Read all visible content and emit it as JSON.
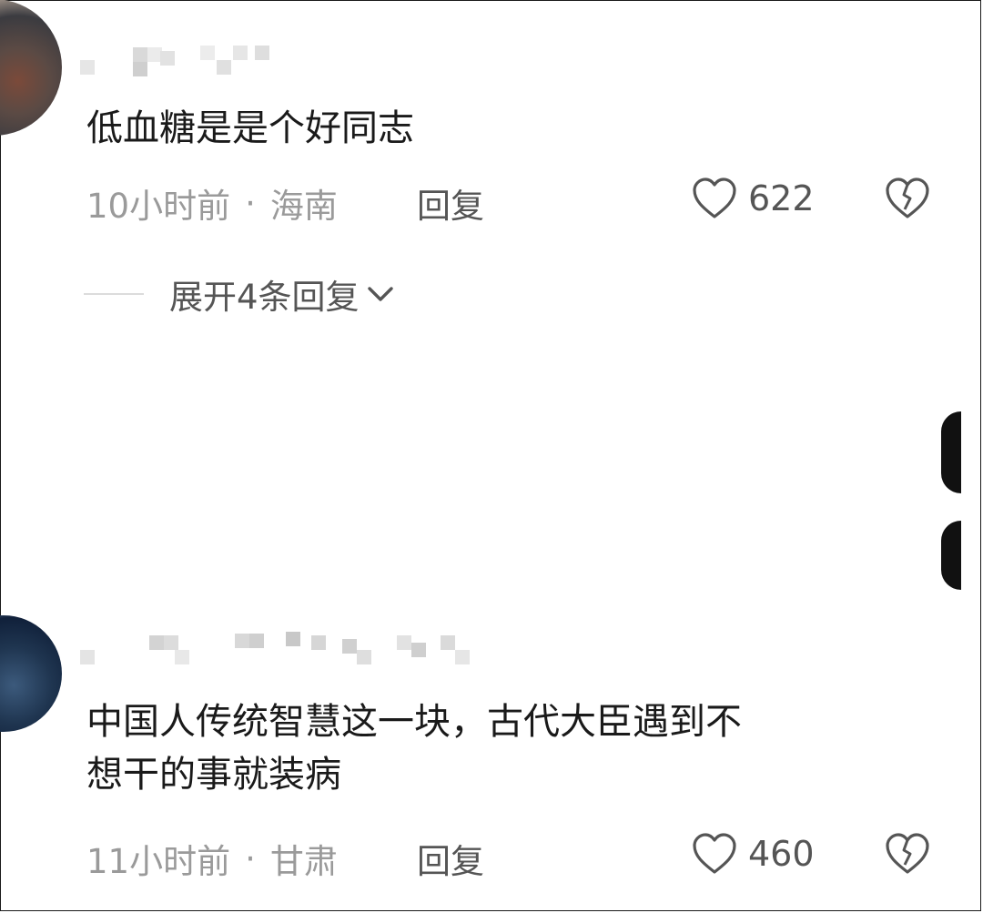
{
  "comments": [
    {
      "text": "低血糖是是个好同志",
      "time": "10小时前",
      "location": "海南",
      "reply_label": "回复",
      "likes": "622",
      "expand_label": "展开4条回复"
    },
    {
      "text": "中国人传统智慧这一块，古代大臣遇到不\n想干的事就装病",
      "time": "11小时前",
      "location": "甘肃",
      "reply_label": "回复",
      "likes": "460"
    }
  ],
  "icons": {
    "like": "heart-outline-icon",
    "dislike": "broken-heart-icon",
    "expand": "chevron-down-icon"
  },
  "colors": {
    "text": "#1a1a1a",
    "meta": "#9a9a9a",
    "action": "#555555"
  }
}
